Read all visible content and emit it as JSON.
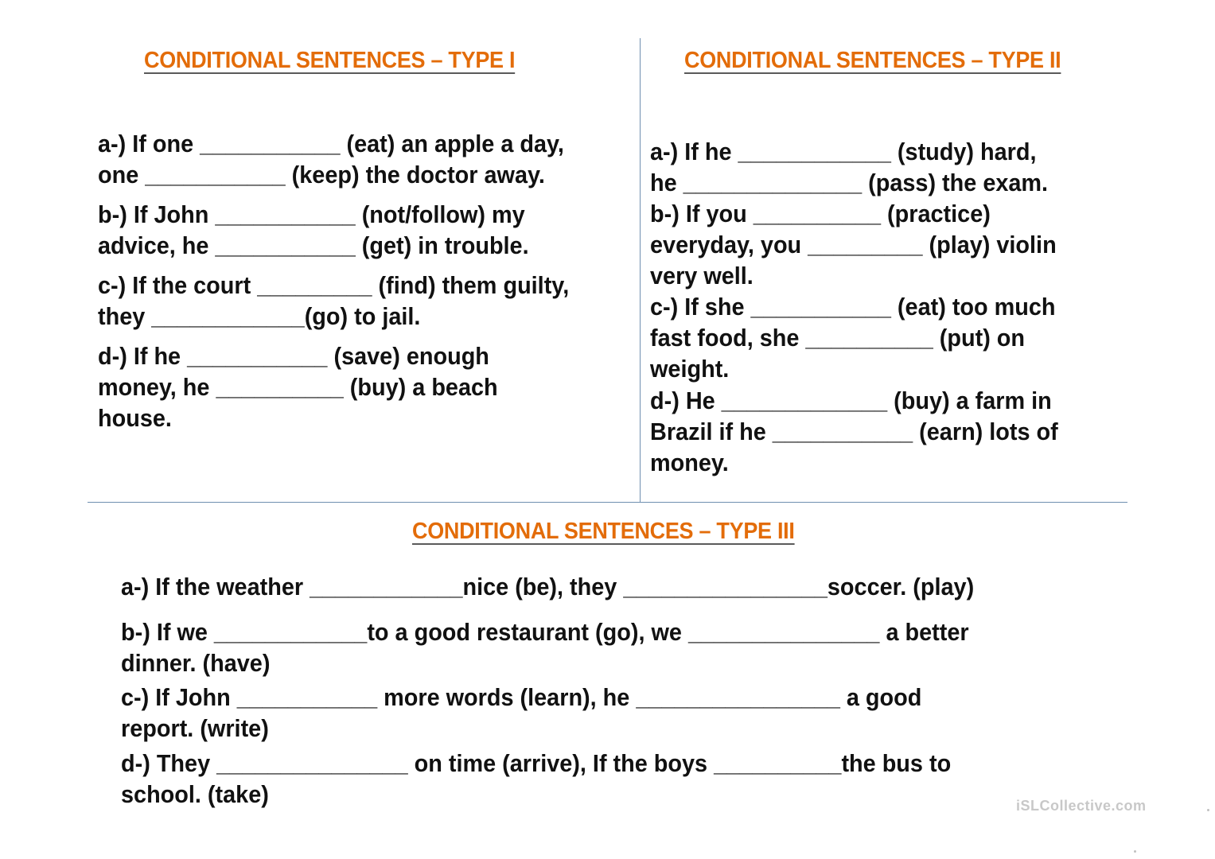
{
  "worksheet": {
    "type1": {
      "title": "CONDITIONAL SENTENCES – TYPE I",
      "lines": [
        "a-) If one ___________ (eat) an apple a day,",
        "one ___________ (keep) the doctor away.",
        "b-) If John ___________ (not/follow) my",
        "advice, he ___________ (get) in trouble.",
        "c-) If the court _________ (find) them guilty,",
        "they ____________(go) to jail.",
        "d-) If he ___________ (save) enough",
        "money, he __________ (buy) a beach",
        "house."
      ]
    },
    "type2": {
      "title": "CONDITIONAL SENTENCES – TYPE II",
      "lines": [
        "a-) If he ____________ (study) hard,",
        "he ______________ (pass) the exam.",
        "b-) If you __________ (practice)",
        "everyday, you _________ (play) violin",
        "very well.",
        "c-) If she ___________ (eat) too much",
        "fast food, she __________ (put) on",
        "weight.",
        "d-) He _____________ (buy) a farm in",
        "Brazil if he ___________ (earn) lots of",
        "money."
      ]
    },
    "type3": {
      "title": "CONDITIONAL SENTENCES – TYPE III",
      "lines": [
        "a-) If the weather ____________nice (be), they ________________soccer. (play)",
        "b-) If we ____________to a good restaurant (go), we _______________ a better",
        "dinner. (have)",
        "c-) If John ___________ more words (learn), he ________________ a good",
        "report. (write)",
        "d-) They _______________ on time (arrive), If the boys __________the bus to",
        "school. (take)"
      ]
    }
  },
  "watermark": "iSLCollective.com",
  "colors": {
    "title": "#e36c09",
    "text": "#111111",
    "divider": "#6f8fb0"
  }
}
